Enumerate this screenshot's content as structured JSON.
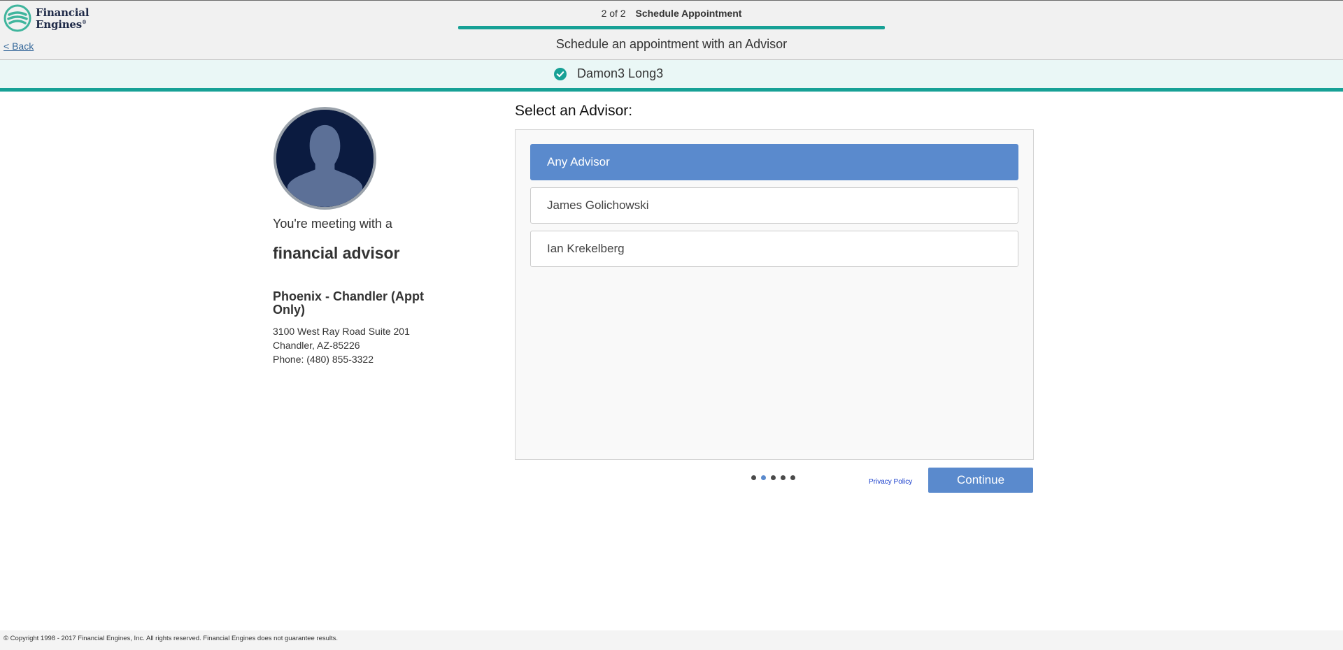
{
  "colors": {
    "brand_teal": "#17a196",
    "accent_blue": "#5a8acd",
    "logo_navy": "#1f2a48",
    "avatar_bg": "#0b1b40"
  },
  "header": {
    "logo_line1": "Financial",
    "logo_line2": "Engines",
    "logo_icon": "financial-engines-logo-icon",
    "back_label": "< Back",
    "step_count": "2 of 2",
    "step_title": "Schedule Appointment",
    "progress_percent": 100,
    "subtitle": "Schedule an appointment with an Advisor"
  },
  "client": {
    "check_icon": "check-circle-icon",
    "name": "Damon3 Long3"
  },
  "advisor_info": {
    "avatar_icon": "person-silhouette-icon",
    "meeting_text": "You're meeting with a",
    "role": "financial advisor",
    "office_name": "Phoenix - Chandler (Appt Only)",
    "address_line1": "3100 West Ray Road Suite 201",
    "address_line2": "Chandler, AZ-85226",
    "phone": "Phone: (480) 855-3322"
  },
  "selection": {
    "heading": "Select an Advisor:",
    "options": [
      {
        "label": "Any Advisor",
        "selected": true
      },
      {
        "label": "James Golichowski",
        "selected": false
      },
      {
        "label": "Ian Krekelberg",
        "selected": false
      }
    ]
  },
  "footer_controls": {
    "pager_dots": 5,
    "pager_active_index": 1,
    "privacy_label": "Privacy Policy",
    "continue_label": "Continue"
  },
  "copyright": "© Copyright 1998 - 2017 Financial Engines, Inc. All rights reserved. Financial Engines does not guarantee results."
}
